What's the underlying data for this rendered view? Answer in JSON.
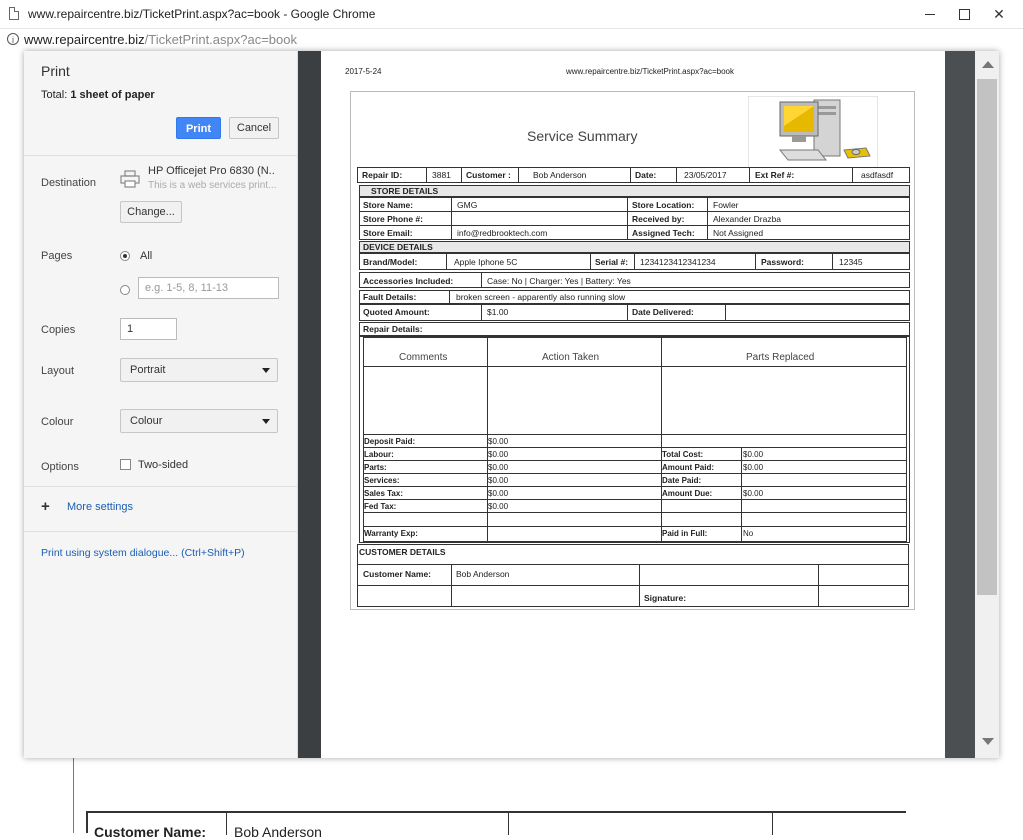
{
  "window": {
    "title": "www.repaircentre.biz/TicketPrint.aspx?ac=book - Google Chrome",
    "url_host": "www.repaircentre.biz",
    "url_path": "/TicketPrint.aspx?ac=book"
  },
  "dialog": {
    "title": "Print",
    "total_prefix": "Total: ",
    "total_value": "1 sheet of paper",
    "print_label": "Print",
    "cancel_label": "Cancel",
    "destination": {
      "label": "Destination",
      "printer_name": "HP Officejet Pro 6830 (N..",
      "printer_sub": "This is a web services print...",
      "change_label": "Change..."
    },
    "pages": {
      "label": "Pages",
      "all_label": "All",
      "custom_placeholder": "e.g. 1-5, 8, 11-13"
    },
    "copies": {
      "label": "Copies",
      "value": "1"
    },
    "layout": {
      "label": "Layout",
      "value": "Portrait"
    },
    "colour": {
      "label": "Colour",
      "value": "Colour"
    },
    "options": {
      "label": "Options",
      "two_sided_label": "Two-sided"
    },
    "more_settings_label": "More settings",
    "system_dialog_link": "Print using system dialogue... (Ctrl+Shift+P)"
  },
  "preview": {
    "header_date": "2017-5-24",
    "header_url": "www.repaircentre.biz/TicketPrint.aspx?ac=book",
    "title": "Service Summary",
    "row1": {
      "repair_id_label": "Repair ID:",
      "repair_id": "3881",
      "customer_label": "Customer :",
      "customer": "Bob Anderson",
      "date_label": "Date:",
      "date": "23/05/2017",
      "ext_ref_label": "Ext Ref #:",
      "ext_ref": "asdfasdf"
    },
    "store_details": {
      "header": "STORE DETAILS",
      "name_label": "Store Name:",
      "name": "GMG",
      "location_label": "Store Location:",
      "location": "Fowler",
      "phone_label": "Store Phone #:",
      "phone": "",
      "received_label": "Received by:",
      "received": "Alexander Drazba",
      "email_label": "Store Email:",
      "email": "info@redbrooktech.com",
      "tech_label": "Assigned Tech:",
      "tech": "Not Assigned"
    },
    "device_details": {
      "header": "DEVICE DETAILS",
      "brand_label": "Brand/Model:",
      "brand": "Apple Iphone 5C",
      "serial_label": "Serial #:",
      "serial": "1234123412341234",
      "password_label": "Password:",
      "password": "12345",
      "accessories_label": "Accessories Included:",
      "accessories": "Case: No  |  Charger: Yes  |  Battery: Yes",
      "fault_label": "Fault Details:",
      "fault": "broken screen - apparently also running slow",
      "quoted_label": "Quoted Amount:",
      "quoted": "$1.00",
      "delivered_label": "Date Delivered:",
      "delivered": ""
    },
    "repair_details": {
      "header": "Repair Details:",
      "col_comments": "Comments",
      "col_action": "Action Taken",
      "col_parts": "Parts Replaced",
      "deposit_label": "Deposit Paid:",
      "deposit": "$0.00",
      "labour_label": "Labour:",
      "labour": "$0.00",
      "parts_label": "Parts:",
      "parts": "$0.00",
      "services_label": "Services:",
      "services": "$0.00",
      "sales_tax_label": "Sales Tax:",
      "sales_tax": "$0.00",
      "fed_tax_label": "Fed Tax:",
      "fed_tax": "$0.00",
      "warranty_label": "Warranty Exp:",
      "warranty": "",
      "total_cost_label": "Total Cost:",
      "total_cost": "$0.00",
      "amount_paid_label": "Amount Paid:",
      "amount_paid": "$0.00",
      "date_paid_label": "Date Paid:",
      "date_paid": "",
      "amount_due_label": "Amount Due:",
      "amount_due": "$0.00",
      "paid_full_label": "Paid in Full:",
      "paid_full": "No"
    },
    "customer_details": {
      "header": "CUSTOMER DETAILS",
      "name_label": "Customer Name:",
      "name": "Bob Anderson",
      "signature_label": "Signature:"
    }
  },
  "background": {
    "customer_name_label": "Customer Name:",
    "customer_name": "Bob Anderson"
  }
}
